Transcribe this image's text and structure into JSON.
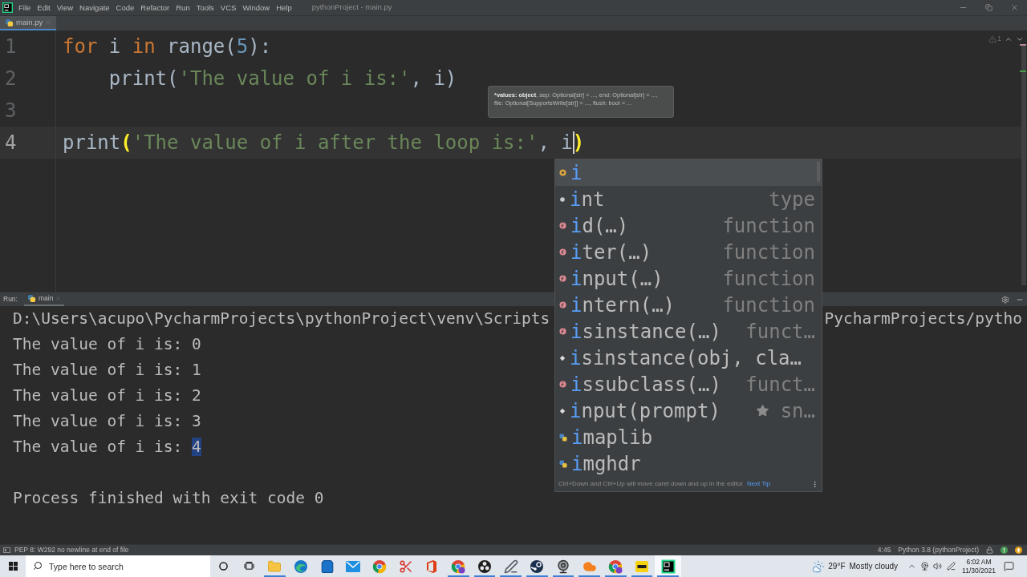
{
  "menu_bar": {
    "items": [
      "File",
      "Edit",
      "View",
      "Navigate",
      "Code",
      "Refactor",
      "Run",
      "Tools",
      "VCS",
      "Window",
      "Help"
    ],
    "title": "pythonProject - main.py"
  },
  "editor_tabs": [
    {
      "label": "main.py",
      "selected": true
    }
  ],
  "editor": {
    "inspection": {
      "count": "1"
    },
    "lines": [
      {
        "number": "1",
        "current": false,
        "tokens": [
          {
            "text": "for",
            "kind": "keyword"
          },
          {
            "text": " i ",
            "kind": "plain"
          },
          {
            "text": "in",
            "kind": "keyword"
          },
          {
            "text": " range(",
            "kind": "plain"
          },
          {
            "text": "5",
            "kind": "number"
          },
          {
            "text": "):",
            "kind": "plain"
          }
        ]
      },
      {
        "number": "2",
        "current": false,
        "tokens": [
          {
            "text": "    print(",
            "kind": "plain"
          },
          {
            "text": "'The value of i is:'",
            "kind": "string"
          },
          {
            "text": ", i)",
            "kind": "plain"
          }
        ]
      },
      {
        "number": "3",
        "current": false
      },
      {
        "number": "4",
        "current": true,
        "tokens": [
          {
            "text": "print",
            "kind": "plain"
          },
          {
            "text": "(",
            "kind": "brace"
          },
          {
            "text": "'The value of i after the loop is:'",
            "kind": "string"
          },
          {
            "text": ", ",
            "kind": "plain"
          },
          {
            "text": "i",
            "kind": "plain",
            "caret_after": true
          },
          {
            "text": ")",
            "kind": "brace"
          }
        ]
      }
    ]
  },
  "parameter_hint": {
    "current": "*values: object",
    "rest": ", sep: Optional[str] = ..., end: Optional[str] = ..., file: Optional[SupportsWrite[str]] = ..., flush: bool = ..."
  },
  "completion": {
    "items": [
      {
        "label": "i",
        "kind": "variable",
        "selected": true,
        "starred": false
      },
      {
        "label": "int",
        "type": "type",
        "kind": "class",
        "selected": false,
        "starred": false
      },
      {
        "label": "id(…)",
        "type": "function",
        "kind": "function",
        "selected": false,
        "starred": false
      },
      {
        "label": "iter(…)",
        "type": "function",
        "kind": "function",
        "selected": false,
        "starred": false
      },
      {
        "label": "input(…)",
        "type": "function",
        "kind": "function",
        "selected": false,
        "starred": false
      },
      {
        "label": "intern(…)",
        "type": "function",
        "kind": "function",
        "selected": false,
        "starred": false
      },
      {
        "label": "isinstance(…)",
        "type": "funct…",
        "kind": "function",
        "selected": false,
        "starred": false
      },
      {
        "label": "isinstance(obj, cla…",
        "kind": "template",
        "selected": false,
        "starred": false
      },
      {
        "label": "issubclass(…)",
        "type": "funct…",
        "kind": "function",
        "selected": false,
        "starred": false
      },
      {
        "label": "input(prompt)",
        "type": "sn…",
        "kind": "template",
        "selected": false,
        "starred": true
      },
      {
        "label": "imaplib",
        "kind": "module",
        "selected": false,
        "starred": false
      },
      {
        "label": "imghdr",
        "kind": "module",
        "selected": false,
        "starred": false
      }
    ],
    "footer": {
      "tip": "Ctrl+Down and Ctrl+Up will move caret down and up in the editor",
      "link": "Next Tip"
    }
  },
  "run_panel": {
    "label": "Run:",
    "tabs": [
      {
        "label": "main",
        "selected": true
      }
    ],
    "lines": [
      {
        "kind": "command",
        "segments": [
          {
            "text": "D:\\Users\\acupo\\PycharmProjects\\pythonProject\\venv\\Scripts",
            "selected": false
          }
        ],
        "tail": "PycharmProjects/pytho"
      },
      {
        "kind": "output",
        "segments": [
          {
            "text": "The value of i is: 0",
            "selected": false
          }
        ]
      },
      {
        "kind": "output",
        "segments": [
          {
            "text": "The value of i is: 1",
            "selected": false
          }
        ]
      },
      {
        "kind": "output",
        "segments": [
          {
            "text": "The value of i is: 2",
            "selected": false
          }
        ]
      },
      {
        "kind": "output",
        "segments": [
          {
            "text": "The value of i is: 3",
            "selected": false
          }
        ]
      },
      {
        "kind": "output",
        "segments": [
          {
            "text": "The value of i is: ",
            "selected": false
          },
          {
            "text": "4",
            "selected": true
          }
        ]
      },
      {
        "kind": "exit",
        "segments": [
          {
            "text": "Process finished with exit code 0",
            "selected": false
          }
        ]
      }
    ]
  },
  "status_bar": {
    "message": "PEP 8: W292 no newline at end of file",
    "position": "4:45",
    "interpreter": "Python 3.8 (pythonProject)"
  },
  "taskbar": {
    "search": {
      "placeholder": "Type here to search"
    },
    "apps": [
      {
        "kind": "explorer",
        "running": true,
        "selected": false
      },
      {
        "kind": "edge",
        "running": false,
        "selected": false
      },
      {
        "kind": "store",
        "running": false,
        "selected": false
      },
      {
        "kind": "mail",
        "running": false,
        "selected": false
      },
      {
        "kind": "chrome",
        "running": false,
        "selected": false
      },
      {
        "kind": "snip",
        "running": false,
        "selected": false
      },
      {
        "kind": "office",
        "running": false,
        "selected": false
      },
      {
        "kind": "chrome_profile",
        "running": true,
        "selected": false
      },
      {
        "kind": "obs",
        "running": true,
        "selected": false
      },
      {
        "kind": "paint",
        "running": true,
        "selected": false
      },
      {
        "kind": "steam",
        "running": true,
        "selected": false
      },
      {
        "kind": "camera",
        "running": true,
        "selected": false
      },
      {
        "kind": "cloud",
        "running": true,
        "selected": false
      },
      {
        "kind": "chrome_profile",
        "running": true,
        "selected": false
      },
      {
        "kind": "pdf",
        "running": true,
        "selected": false
      },
      {
        "kind": "ide",
        "running": true,
        "selected": true
      }
    ],
    "weather": {
      "temperature": "29°F",
      "condition": "Mostly cloudy"
    },
    "time": "6:02 AM",
    "date": "11/30/2021"
  }
}
